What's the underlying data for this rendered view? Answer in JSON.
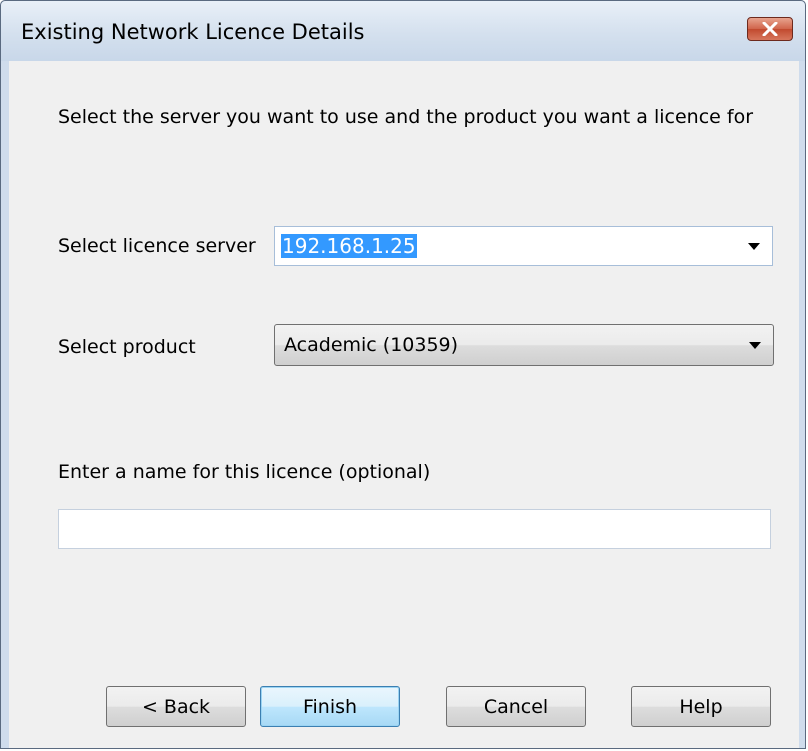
{
  "window": {
    "title": "Existing Network Licence Details"
  },
  "dialog": {
    "instruction": "Select the server you want to use and the product you want a licence for",
    "server_label": "Select licence server",
    "server_value": "192.168.1.25",
    "product_label": "Select product",
    "product_value": "Academic (10359)",
    "name_label": "Enter a name for this licence (optional)",
    "name_value": ""
  },
  "buttons": {
    "back": "< Back",
    "finish": "Finish",
    "cancel": "Cancel",
    "help": "Help"
  },
  "icons": {
    "close": "close-icon",
    "dropdown": "chevron-down-icon"
  },
  "colors": {
    "selection": "#3399ff",
    "close_button": "#c9553a",
    "title_bar": "#d4e0ee"
  }
}
